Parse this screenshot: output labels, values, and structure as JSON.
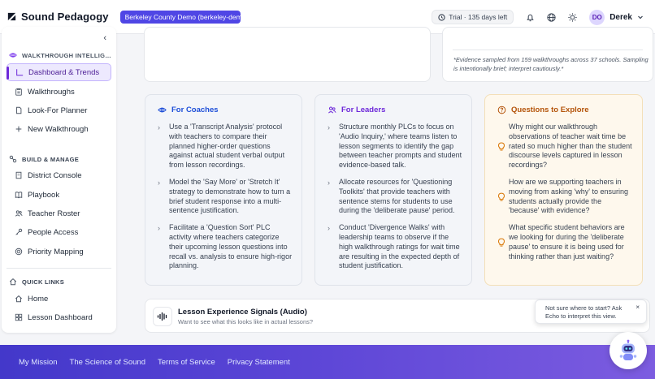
{
  "app": {
    "name": "Sound Pedagogy",
    "org_pill": "Berkeley County Demo (berkeley-demo",
    "trial": "Trial · 135 days left",
    "user_initials": "DO",
    "user_name": "Derek"
  },
  "sidebar": {
    "collapse_glyph": "‹",
    "sections": {
      "walkthrough": "WALKTHROUGH INTELLIG…",
      "build": "BUILD & MANAGE",
      "quick": "QUICK LINKS"
    },
    "items": {
      "dashboard": "Dashboard & Trends",
      "walkthroughs": "Walkthroughs",
      "lookfor": "Look-For Planner",
      "new_walkthrough": "New Walkthrough",
      "district": "District Console",
      "playbook": "Playbook",
      "roster": "Teacher Roster",
      "people": "People Access",
      "priority": "Priority Mapping",
      "home": "Home",
      "lesson": "Lesson Dashboard"
    }
  },
  "evidence_note": "*Evidence sampled from 159 walkthroughs across 37 schools. Sampling is intentionally brief; interpret cautiously.*",
  "coaches": {
    "title": "For Coaches",
    "items": [
      "Use a 'Transcript Analysis' protocol with teachers to compare their planned higher-order questions against actual student verbal output from lesson recordings.",
      "Model the 'Say More' or 'Stretch It' strategy to demonstrate how to turn a brief student response into a multi-sentence justification.",
      "Facilitate a 'Question Sort' PLC activity where teachers categorize their upcoming lesson questions into recall vs. analysis to ensure high-rigor planning."
    ]
  },
  "leaders": {
    "title": "For Leaders",
    "items": [
      "Structure monthly PLCs to focus on 'Audio Inquiry,' where teams listen to lesson segments to identify the gap between teacher prompts and student evidence-based talk.",
      "Allocate resources for 'Questioning Toolkits' that provide teachers with sentence stems for students to use during the 'deliberate pause' period.",
      "Conduct 'Divergence Walks' with leadership teams to observe if the high walkthrough ratings for wait time are resulting in the expected depth of student justification."
    ]
  },
  "questions": {
    "title": "Questions to Explore",
    "items": [
      "Why might our walkthrough observations of teacher wait time be rated so much higher than the student discourse levels captured in lesson recordings?",
      "How are we supporting teachers in moving from asking 'why' to ensuring students actually provide the 'because' with evidence?",
      "What specific student behaviors are we looking for during the 'deliberate pause' to ensure it is being used for thinking rather than just waiting?"
    ]
  },
  "signals": {
    "title": "Lesson Experience Signals (Audio)",
    "subtitle": "Want to see what this looks like in actual lessons?"
  },
  "tooltip": {
    "text": "Not sure where to start? Ask Echo to interpret this view.",
    "close": "×"
  },
  "footer": {
    "links": [
      "My Mission",
      "The Science of Sound",
      "Terms of Service",
      "Privacy Statement"
    ]
  },
  "colors": {
    "accent": "#4f46e5",
    "coach": "#1d4ed8",
    "leader": "#6d28d9",
    "question": "#b45309"
  }
}
